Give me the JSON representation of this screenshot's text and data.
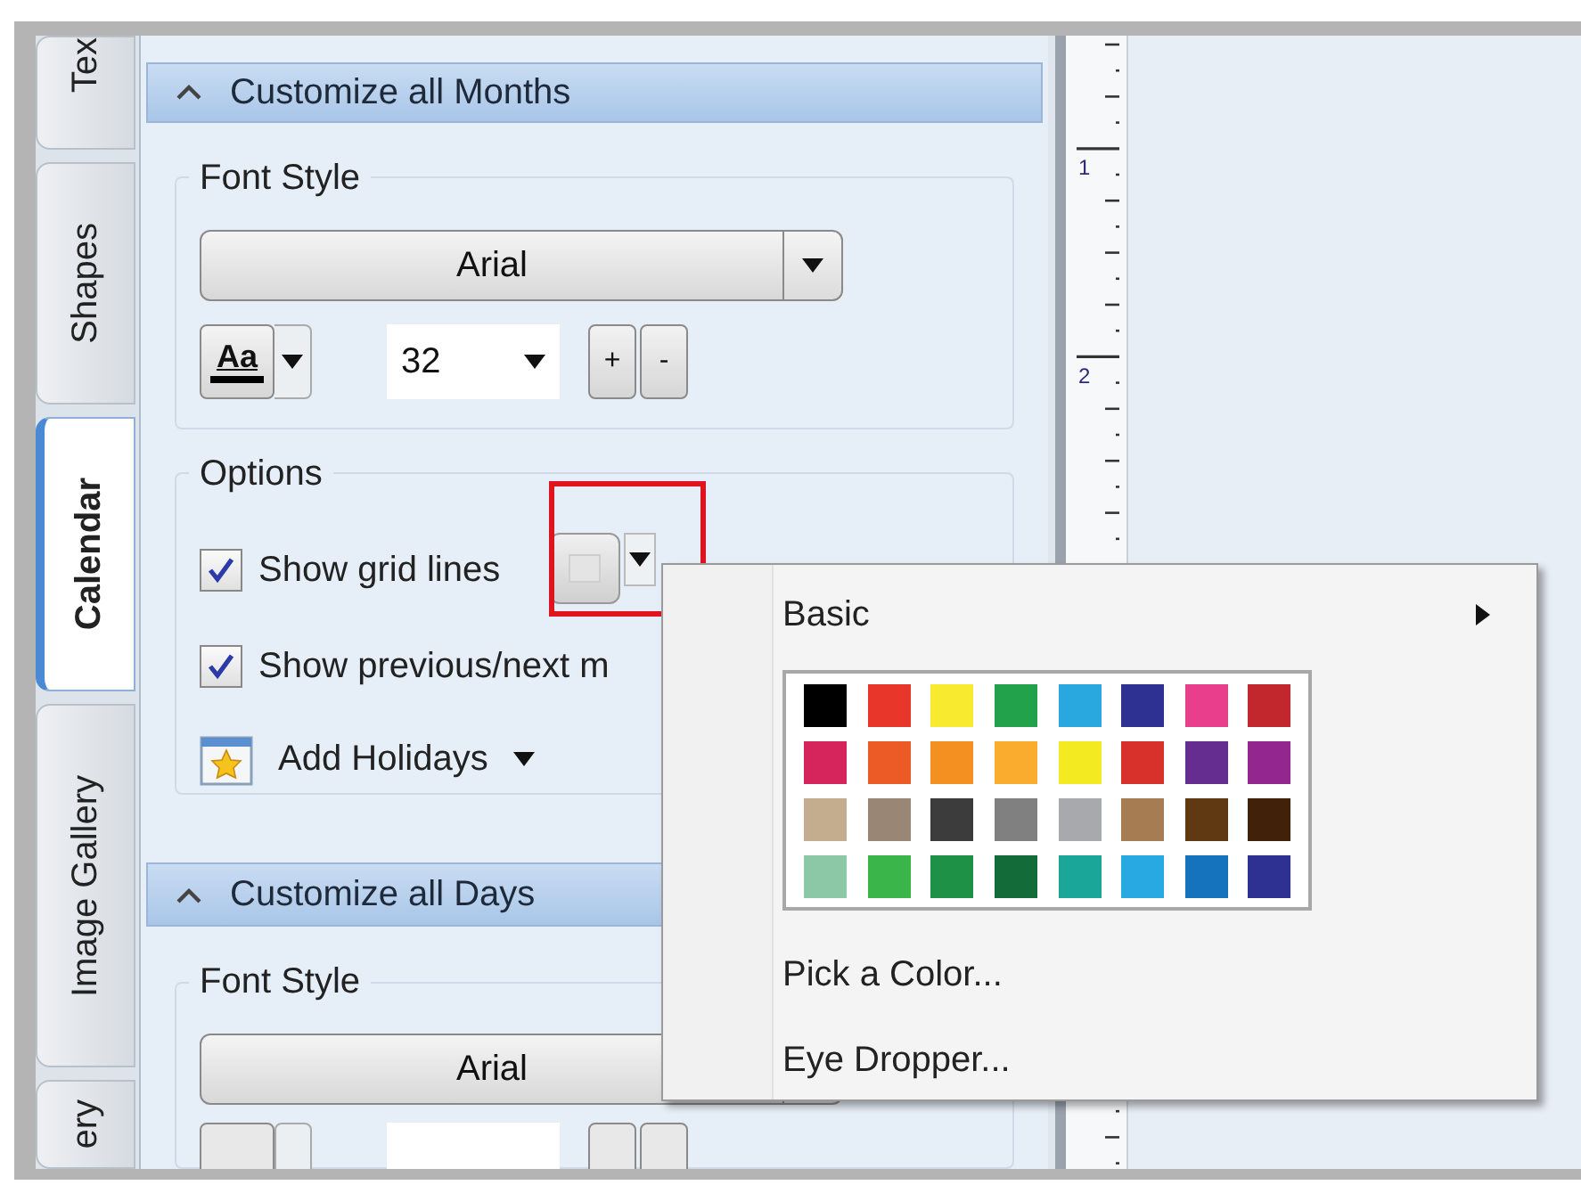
{
  "tabs": [
    {
      "label": "Tex",
      "selected": false
    },
    {
      "label": "Shapes",
      "selected": false
    },
    {
      "label": "Calendar",
      "selected": true
    },
    {
      "label": "Image Gallery",
      "selected": false
    },
    {
      "label": "ery",
      "selected": false
    }
  ],
  "sections": [
    {
      "title": "Customize all Months",
      "expanded": true,
      "font_group": {
        "label": "Font Style",
        "font": "Arial",
        "color_label": "Aa",
        "size": "32",
        "plus": "+",
        "minus": "-"
      },
      "options": {
        "label": "Options",
        "checkboxes": [
          {
            "label": "Show grid lines",
            "checked": true
          },
          {
            "label": "Show previous/next m",
            "checked": true
          }
        ],
        "holidays": "Add Holidays"
      }
    },
    {
      "title": "Customize all Days",
      "expanded": true,
      "font_group": {
        "label": "Font Style",
        "font": "Arial"
      }
    }
  ],
  "ruler": {
    "labels": [
      "1",
      "2"
    ]
  },
  "color_menu": {
    "basic": "Basic",
    "swatches": [
      {
        "color": "#000000"
      },
      {
        "color": "#e8372a"
      },
      {
        "color": "#f7ea2f"
      },
      {
        "color": "#22a24a"
      },
      {
        "color": "#29a8e0"
      },
      {
        "color": "#2e3192"
      },
      {
        "color": "#e83e8c"
      },
      {
        "color": "#c1272d"
      },
      {
        "color": "#d6245c"
      },
      {
        "color": "#ec5a26"
      },
      {
        "color": "#f39021"
      },
      {
        "color": "#f9ac2e"
      },
      {
        "color": "#f4ea22"
      },
      {
        "color": "#d8302b"
      },
      {
        "color": "#662d91"
      },
      {
        "color": "#93278f"
      },
      {
        "color": "#c4ad8f"
      },
      {
        "color": "#998675"
      },
      {
        "color": "#3c3c3c"
      },
      {
        "color": "#808080"
      },
      {
        "color": "#a7a9ac"
      },
      {
        "color": "#a67c52"
      },
      {
        "color": "#603913"
      },
      {
        "color": "#42210b"
      },
      {
        "color": "#8cc7a6"
      },
      {
        "color": "#39b54a"
      },
      {
        "color": "#1e9146"
      },
      {
        "color": "#146b3a"
      },
      {
        "color": "#1aa79a"
      },
      {
        "color": "#29a9e1"
      },
      {
        "color": "#1572bc"
      },
      {
        "color": "#2e3192"
      }
    ],
    "pick": "Pick a Color...",
    "dropper": "Eye Dropper..."
  }
}
